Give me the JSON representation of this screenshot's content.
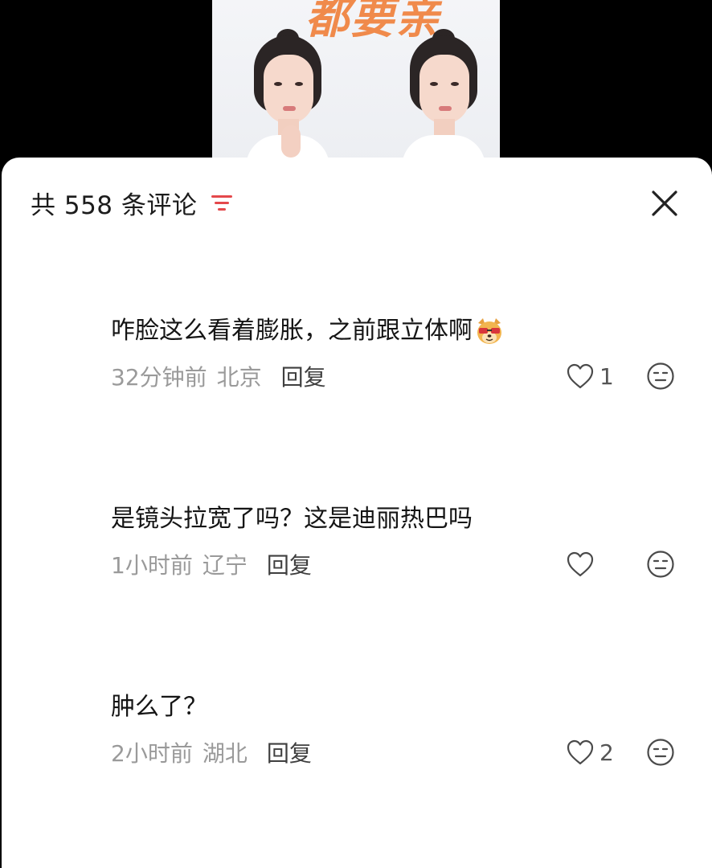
{
  "video_preview": {
    "title_art": "都要亲"
  },
  "comment_sheet": {
    "header": {
      "count_label": "共 558 条评论"
    },
    "comments": [
      {
        "text": "咋脸这么看着膨胀，之前跟立体啊",
        "emoji": "dog-sunglasses-emoji",
        "time": "32分钟前",
        "region": "北京",
        "reply_label": "回复",
        "likes": "1"
      },
      {
        "text": "是镜头拉宽了吗？这是迪丽热巴吗",
        "time": "1小时前",
        "region": "辽宁",
        "reply_label": "回复",
        "likes": ""
      },
      {
        "text": "肿么了？",
        "time": "2小时前",
        "region": "湖北",
        "reply_label": "回复",
        "likes": "2"
      }
    ]
  },
  "colors": {
    "sort_icon": "#e4484b",
    "title_art": "#f08a4b",
    "meta_text": "#9a9a9a"
  }
}
